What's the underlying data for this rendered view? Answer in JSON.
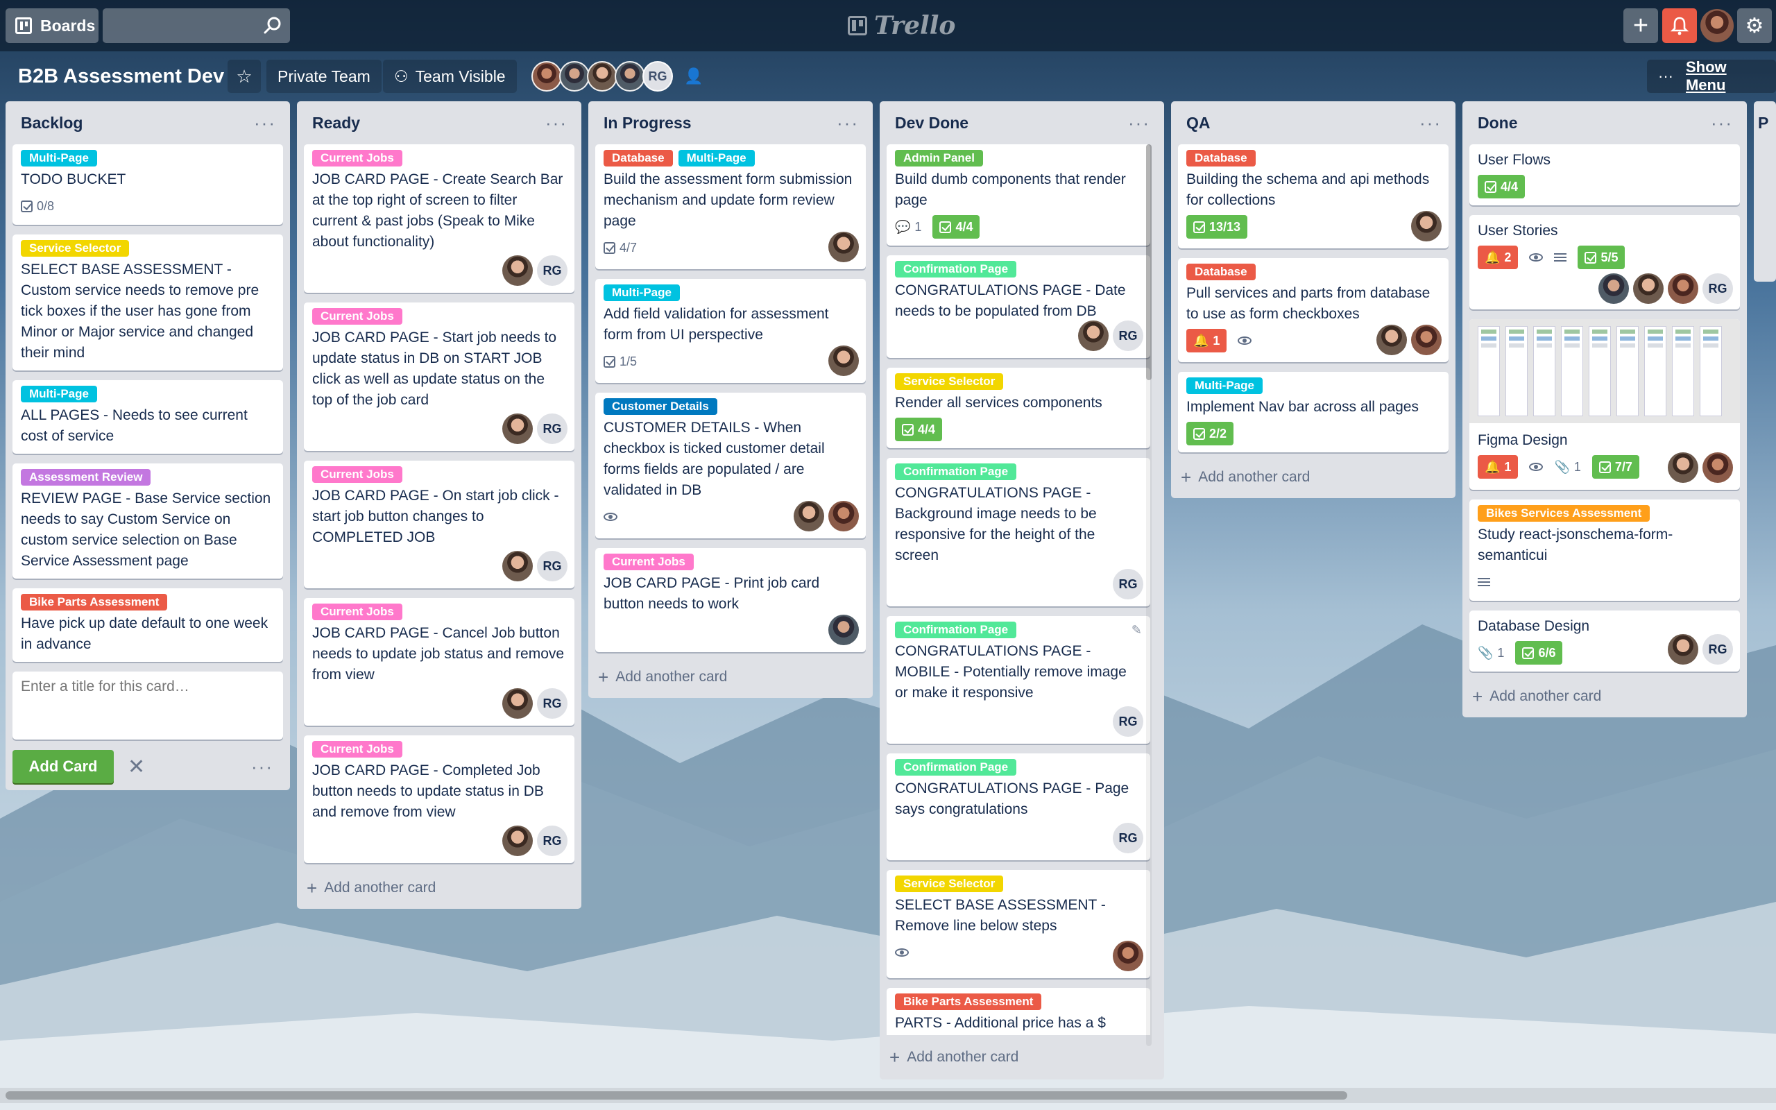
{
  "topbar": {
    "boards_label": "Boards",
    "search_placeholder": "",
    "logo_text": "Trello"
  },
  "board": {
    "title": "B2B Assessment Dev",
    "team_label": "Private Team",
    "visibility_label": "Team Visible",
    "member_initials": "RG",
    "show_menu_label": "Show Menu"
  },
  "colors": {
    "green": "#61bd4f",
    "red": "#eb5a46",
    "orange": "#ff9f1a",
    "yellow": "#f2d600",
    "purple": "#c377e0",
    "blue": "#0079bf",
    "sky": "#00c2e0",
    "pink": "#ff78cb"
  },
  "lists": [
    {
      "title": "Backlog",
      "cards": [
        {
          "labels": [
            {
              "text": "Multi-Page",
              "color": "#00c2e0"
            }
          ],
          "text": "TODO BUCKET",
          "checklist": "0/8"
        },
        {
          "labels": [
            {
              "text": "Service Selector",
              "color": "#f2d600"
            }
          ],
          "text": "SELECT BASE ASSESSMENT - Custom service needs to remove pre tick boxes if the user has gone from Minor or Major service and changed their mind"
        },
        {
          "labels": [
            {
              "text": "Multi-Page",
              "color": "#00c2e0"
            }
          ],
          "text": "ALL PAGES - Needs to see current cost of service"
        },
        {
          "labels": [
            {
              "text": "Assessment Review",
              "color": "#c377e0"
            }
          ],
          "text": "REVIEW PAGE - Base Service section needs to say Custom Service on custom service selection on Base Service Assessment page"
        },
        {
          "labels": [
            {
              "text": "Bike Parts Assessment",
              "color": "#eb5a46"
            }
          ],
          "text": "Have pick up date default to one week in advance"
        }
      ],
      "composer": {
        "placeholder": "Enter a title for this card…",
        "add_label": "Add Card"
      }
    },
    {
      "title": "Ready",
      "cards": [
        {
          "labels": [
            {
              "text": "Current Jobs",
              "color": "#ff78cb"
            }
          ],
          "text": "JOB CARD PAGE - Create Search Bar at the top right of screen to filter current & past jobs (Speak to Mike about functionality)"
        },
        {
          "labels": [
            {
              "text": "Current Jobs",
              "color": "#ff78cb"
            }
          ],
          "text": "JOB CARD PAGE - Start job needs to update status in DB on START JOB click as well as update status on the top of the job card"
        },
        {
          "labels": [
            {
              "text": "Current Jobs",
              "color": "#ff78cb"
            }
          ],
          "text": "JOB CARD PAGE - On start job click - start job button changes to COMPLETED JOB"
        },
        {
          "labels": [
            {
              "text": "Current Jobs",
              "color": "#ff78cb"
            }
          ],
          "text": "JOB CARD PAGE - Cancel Job button needs to update job status and remove from view"
        },
        {
          "labels": [
            {
              "text": "Current Jobs",
              "color": "#ff78cb"
            }
          ],
          "text": "JOB CARD PAGE - Completed Job button needs to update status in DB and remove from view"
        }
      ],
      "add_label": "Add another card"
    },
    {
      "title": "In Progress",
      "cards": [
        {
          "labels": [
            {
              "text": "Database",
              "color": "#eb5a46"
            },
            {
              "text": "Multi-Page",
              "color": "#00c2e0"
            }
          ],
          "text": "Build the assessment form submission mechanism and update form review page",
          "checklist": "4/7"
        },
        {
          "labels": [
            {
              "text": "Multi-Page",
              "color": "#00c2e0"
            }
          ],
          "text": "Add field validation for assessment form from UI perspective",
          "checklist": "1/5"
        },
        {
          "labels": [
            {
              "text": "Customer Details",
              "color": "#0079bf"
            }
          ],
          "text": "CUSTOMER DETAILS - When checkbox is ticked customer detail forms fields are populated / are validated in DB"
        },
        {
          "labels": [
            {
              "text": "Current Jobs",
              "color": "#ff78cb"
            }
          ],
          "text": "JOB CARD PAGE - Print job card button needs to work"
        }
      ],
      "add_label": "Add another card"
    },
    {
      "title": "Dev Done",
      "cards": [
        {
          "labels": [
            {
              "text": "Admin Panel",
              "color": "#61bd4f"
            }
          ],
          "text": "Build dumb components that render page",
          "comments": "1",
          "checklist": "4/4"
        },
        {
          "labels": [
            {
              "text": "Confirmation Page",
              "color": "#51e898"
            }
          ],
          "text": "CONGRATULATIONS PAGE - Date needs to be populated from DB"
        },
        {
          "labels": [
            {
              "text": "Service Selector",
              "color": "#f2d600"
            }
          ],
          "text": "Render all services components",
          "checklist": "4/4"
        },
        {
          "labels": [
            {
              "text": "Confirmation Page",
              "color": "#51e898"
            }
          ],
          "text": "CONGRATULATIONS PAGE - Background image needs to be responsive for the height of the screen"
        },
        {
          "labels": [
            {
              "text": "Confirmation Page",
              "color": "#51e898"
            }
          ],
          "text": "CONGRATULATIONS PAGE - MOBILE - Potentially remove image or make it responsive"
        },
        {
          "labels": [
            {
              "text": "Confirmation Page",
              "color": "#51e898"
            }
          ],
          "text": "CONGRATULATIONS PAGE - Page says congratulations"
        },
        {
          "labels": [
            {
              "text": "Service Selector",
              "color": "#f2d600"
            }
          ],
          "text": "SELECT BASE ASSESSMENT - Remove line below steps"
        },
        {
          "labels": [
            {
              "text": "Bike Parts Assessment",
              "color": "#eb5a46"
            }
          ],
          "text": "PARTS - Additional price has a $"
        }
      ],
      "add_label": "Add another card"
    },
    {
      "title": "QA",
      "cards": [
        {
          "labels": [
            {
              "text": "Database",
              "color": "#eb5a46"
            }
          ],
          "text": "Building the schema and api methods for collections",
          "checklist": "13/13"
        },
        {
          "labels": [
            {
              "text": "Database",
              "color": "#eb5a46"
            }
          ],
          "text": "Pull services and parts from database to use as form checkboxes",
          "alerts": "1"
        },
        {
          "labels": [
            {
              "text": "Multi-Page",
              "color": "#00c2e0"
            }
          ],
          "text": "Implement Nav bar across all pages",
          "checklist": "2/2"
        }
      ],
      "add_label": "Add another card"
    },
    {
      "title": "Done",
      "cards": [
        {
          "labels": [],
          "text": "User Flows",
          "checklist": "4/4"
        },
        {
          "labels": [],
          "text": "User Stories",
          "alerts": "2",
          "checklist": "5/5"
        },
        {
          "labels": [],
          "text": "Figma Design",
          "alerts": "1",
          "attachments": "1",
          "checklist": "7/7"
        },
        {
          "labels": [
            {
              "text": "Bikes Services Assessment",
              "color": "#ff9f1a"
            }
          ],
          "text": "Study react-jsonschema-form-semanticui"
        },
        {
          "labels": [],
          "text": "Database Design",
          "attachments": "1",
          "checklist": "6/6"
        }
      ],
      "add_label": "Add another card"
    }
  ],
  "next_list_hint": "P"
}
